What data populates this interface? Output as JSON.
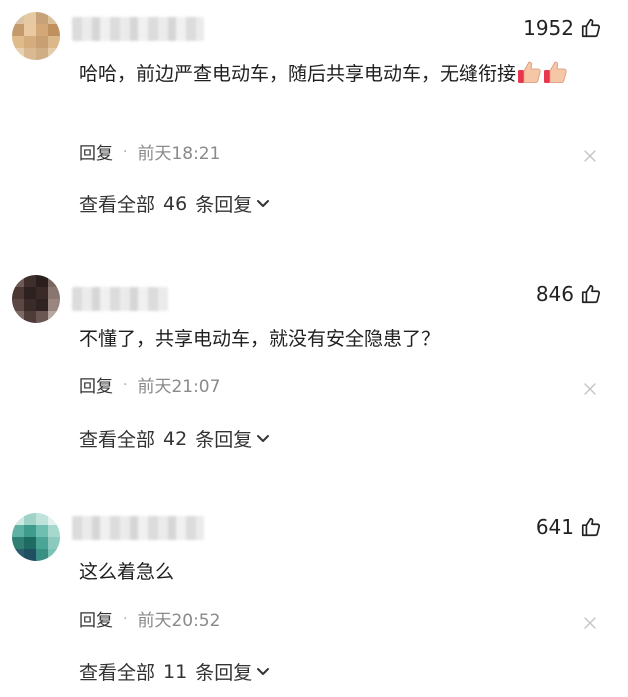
{
  "comments": [
    {
      "likes": "1952",
      "text": "哈哈，前边严查电动车，随后共享电动车，无缝衔接",
      "reply_label": "回复",
      "separator": "·",
      "time": "前天18:21",
      "more_prefix": "查看全部",
      "reply_count": "46",
      "more_suffix": "条回复",
      "avatar_colors": [
        "#d9c4a8",
        "#e4c9a2",
        "#c7a178",
        "#dcc09a",
        "#c49a6c",
        "#e8c9a0",
        "#d2a878",
        "#bf915f",
        "#e0bb8a",
        "#d4ac7e",
        "#c89f72",
        "#dcb78a",
        "#e7d0b0",
        "#d8b991",
        "#cfae86",
        "#e5cba7"
      ],
      "emoji": "thumbs-up-emoji"
    },
    {
      "likes": "846",
      "text": "不懂了，共享电动车，就没有安全隐患了？",
      "reply_label": "回复",
      "separator": "·",
      "time": "前天21:07",
      "more_prefix": "查看全部",
      "reply_count": "42",
      "more_suffix": "条回复",
      "avatar_colors": [
        "#6d5a55",
        "#3f2f2c",
        "#2a1f1d",
        "#7a6762",
        "#4b3835",
        "#2e2220",
        "#3a2a27",
        "#8a7670",
        "#5b4743",
        "#3b2b28",
        "#2f2321",
        "#9a8680",
        "#7d6a66",
        "#4e3c39",
        "#6a5652",
        "#b6a7a2"
      ]
    },
    {
      "likes": "641",
      "text": "这么着急么",
      "reply_label": "回复",
      "separator": "·",
      "time": "前天20:52",
      "more_prefix": "查看全部",
      "reply_count": "11",
      "more_suffix": "条回复",
      "avatar_colors": [
        "#cfe8e2",
        "#9fd3c8",
        "#bfe2da",
        "#e3f1ee",
        "#5fb2a3",
        "#3f9b8c",
        "#6fbfb0",
        "#a7d8ce",
        "#2f7f75",
        "#1e6b63",
        "#4aa596",
        "#8ccabe",
        "#2a5c6e",
        "#1f4f60",
        "#3a8f84",
        "#7ac2b5"
      ]
    }
  ]
}
